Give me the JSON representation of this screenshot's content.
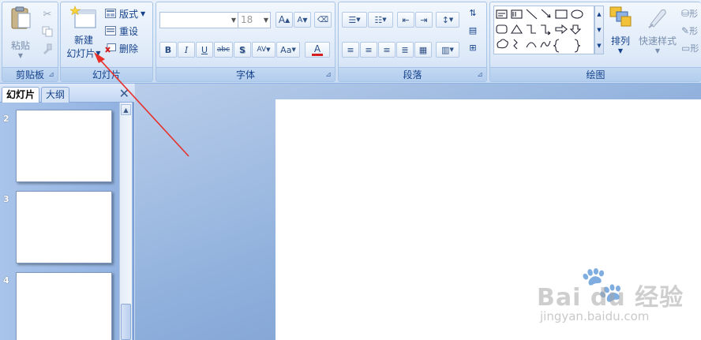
{
  "clipboard": {
    "group_label": "剪贴板",
    "paste_label": "粘贴"
  },
  "slides_group": {
    "group_label": "幻灯片",
    "new_slide_line1": "新建",
    "new_slide_line2": "幻灯片",
    "layout_label": "版式",
    "reset_label": "重设",
    "delete_label": "删除"
  },
  "font_group": {
    "group_label": "字体",
    "font_name_value": "",
    "font_size_value": "18",
    "grow_label": "A",
    "shrink_label": "A",
    "bold_label": "B",
    "italic_label": "I",
    "underline_label": "U",
    "strike_label": "abc",
    "shadow_label": "S",
    "spacing_label": "AV",
    "case_label": "Aa",
    "color_label": "A"
  },
  "paragraph_group": {
    "group_label": "段落"
  },
  "drawing_group": {
    "group_label": "绘图",
    "arrange_label": "排列",
    "quick_styles_label": "快速样式"
  },
  "panel": {
    "tab_slides": "幻灯片",
    "tab_outline": "大纲",
    "close_label": "X",
    "slides": [
      {
        "number": "2"
      },
      {
        "number": "3"
      },
      {
        "number": "4"
      }
    ]
  },
  "watermark": {
    "brand_text": "Bai du 经验",
    "url_text": "jingyan.baidu.com"
  },
  "colors": {
    "annotation_arrow": "#e8302a",
    "ribbon_text": "#15428b"
  }
}
